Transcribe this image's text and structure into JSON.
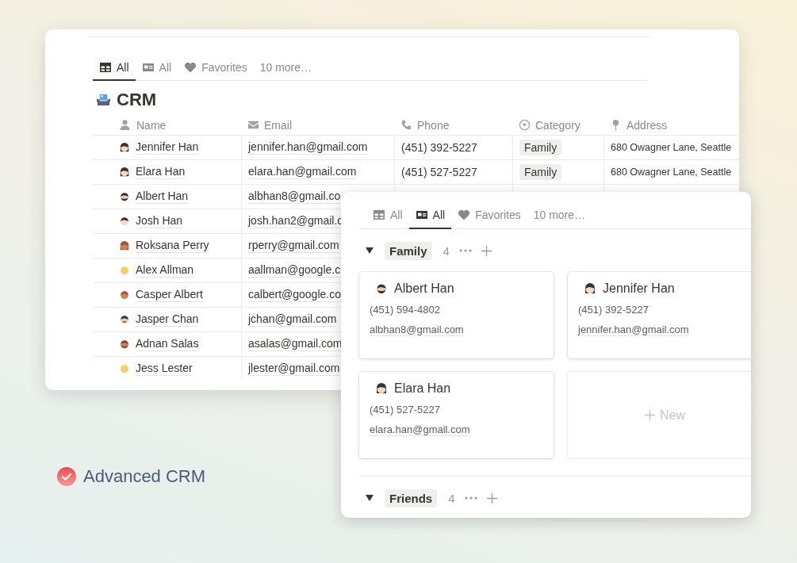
{
  "table_window": {
    "tabs": [
      {
        "label": "All",
        "kind": "table",
        "selected": true
      },
      {
        "label": "All",
        "kind": "gallery",
        "selected": false
      },
      {
        "label": "Favorites",
        "kind": "heart",
        "selected": false
      },
      {
        "label": "10 more…",
        "kind": "more",
        "selected": false
      }
    ],
    "title": "CRM",
    "columns": [
      {
        "label": "Name",
        "kind": "person"
      },
      {
        "label": "Email",
        "kind": "envelope"
      },
      {
        "label": "Phone",
        "kind": "phone"
      },
      {
        "label": "Category",
        "kind": "select"
      },
      {
        "label": "Address",
        "kind": "pin"
      }
    ],
    "rows": [
      {
        "avatar": {
          "kind": "woman-dark"
        },
        "name": "Jennifer Han",
        "email": "jennifer.han@gmail.com",
        "phone": "(451) 392-5227",
        "category": "Family",
        "address": "680 Owagner Lane, Seattle"
      },
      {
        "avatar": {
          "kind": "woman-dark"
        },
        "name": "Elara Han",
        "email": "elara.han@gmail.com",
        "phone": "(451) 527-5227",
        "category": "Family",
        "address": "680 Owagner Lane, Seattle"
      },
      {
        "avatar": {
          "kind": "man-beard"
        },
        "name": "Albert Han",
        "email": "albhan8@gmail.co"
      },
      {
        "avatar": {
          "kind": "man-dark"
        },
        "name": "Josh Han",
        "email": "josh.han2@gmail.c"
      },
      {
        "avatar": {
          "kind": "woman-auburn"
        },
        "name": "Roksana Perry",
        "email": "rperry@gmail.com"
      },
      {
        "avatar": {
          "kind": "blond"
        },
        "name": "Alex Allman",
        "email": "aallman@google.c"
      },
      {
        "avatar": {
          "kind": "man-ginger"
        },
        "name": "Casper Albert",
        "email": "calbert@google.co"
      },
      {
        "avatar": {
          "kind": "man-mustache"
        },
        "name": "Jasper Chan",
        "email": "jchan@gmail.com"
      },
      {
        "avatar": {
          "kind": "man-brown-beard"
        },
        "name": "Adnan Salas",
        "email": "asalas@gmail.com"
      },
      {
        "avatar": {
          "kind": "blond"
        },
        "name": "Jess Lester",
        "email": "jlester@gmail.com"
      }
    ]
  },
  "gallery_window": {
    "tabs": [
      {
        "label": "All",
        "kind": "table",
        "selected": false
      },
      {
        "label": "All",
        "kind": "gallery",
        "selected": true
      },
      {
        "label": "Favorites",
        "kind": "heart",
        "selected": false
      },
      {
        "label": "10 more…",
        "kind": "more",
        "selected": false
      }
    ],
    "groups": [
      {
        "label": "Family",
        "count": "4",
        "expanded": true,
        "cards": [
          {
            "avatar": {
              "kind": "man-beard"
            },
            "name": "Albert Han",
            "phone": "(451) 594-4802",
            "email": "albhan8@gmail.com"
          },
          {
            "avatar": {
              "kind": "woman-dark"
            },
            "name": "Jennifer Han",
            "phone": "(451) 392-5227",
            "email": "jennifer.han@gmail.com"
          },
          {
            "avatar": {
              "kind": "woman-dark"
            },
            "name": "Elara Han",
            "phone": "(451) 527-5227",
            "email": "elara.han@gmail.com"
          }
        ],
        "new_label": "New"
      },
      {
        "label": "Friends",
        "count": "4",
        "expanded": true
      }
    ]
  },
  "brand": {
    "label": "Advanced CRM"
  }
}
